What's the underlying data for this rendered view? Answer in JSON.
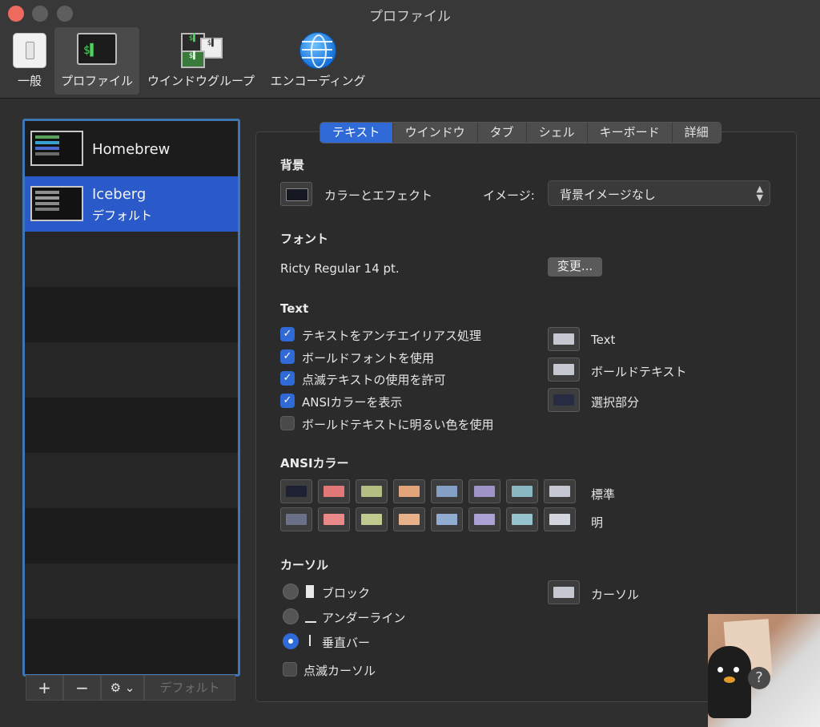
{
  "window": {
    "title": "プロファイル"
  },
  "toolbar": [
    {
      "label": "一般"
    },
    {
      "label": "プロファイル"
    },
    {
      "label": "ウインドウグループ"
    },
    {
      "label": "エンコーディング"
    }
  ],
  "profiles": [
    {
      "name": "Homebrew",
      "subtitle": ""
    },
    {
      "name": "Iceberg",
      "subtitle": "デフォルト"
    }
  ],
  "list_buttons": {
    "add": "+",
    "remove": "−",
    "gear": "⚙ ⌄",
    "default": "デフォルト"
  },
  "tabs": [
    "テキスト",
    "ウインドウ",
    "タブ",
    "シェル",
    "キーボード",
    "詳細"
  ],
  "background": {
    "heading": "背景",
    "color_label": "カラーとエフェクト",
    "image_label": "イメージ:",
    "image_value": "背景イメージなし"
  },
  "font": {
    "heading": "フォント",
    "current": "Ricty Regular 14 pt.",
    "change_button": "変更..."
  },
  "text": {
    "heading": "Text",
    "options": [
      {
        "label": "テキストをアンチエイリアス処理",
        "checked": true
      },
      {
        "label": "ボールドフォントを使用",
        "checked": true
      },
      {
        "label": "点滅テキストの使用を許可",
        "checked": true
      },
      {
        "label": "ANSIカラーを表示",
        "checked": true
      },
      {
        "label": "ボールドテキストに明るい色を使用",
        "checked": false
      }
    ],
    "colors": [
      {
        "label": "Text",
        "color": "#c6c8d1"
      },
      {
        "label": "ボールドテキスト",
        "color": "#c6c8d1"
      },
      {
        "label": "選択部分",
        "color": "#272c42"
      }
    ]
  },
  "ansi": {
    "heading": "ANSIカラー",
    "normal_label": "標準",
    "bright_label": "明",
    "normal": [
      "#1e2132",
      "#e27878",
      "#b4be82",
      "#e2a478",
      "#84a0c6",
      "#a093c7",
      "#89b8c2",
      "#c6c8d1"
    ],
    "bright": [
      "#6b7089",
      "#e98989",
      "#c0ca8e",
      "#e9b189",
      "#91acd1",
      "#ada0d3",
      "#95c4ce",
      "#d2d4de"
    ]
  },
  "cursor": {
    "heading": "カーソル",
    "options": [
      {
        "label": "ブロック",
        "selected": false
      },
      {
        "label": "アンダーライン",
        "selected": false
      },
      {
        "label": "垂直バー",
        "selected": true
      }
    ],
    "blink_label": "点滅カーソル",
    "blink": false,
    "color_label": "カーソル",
    "color": "#c6c8d1"
  },
  "overlay": {
    "help": "?"
  }
}
